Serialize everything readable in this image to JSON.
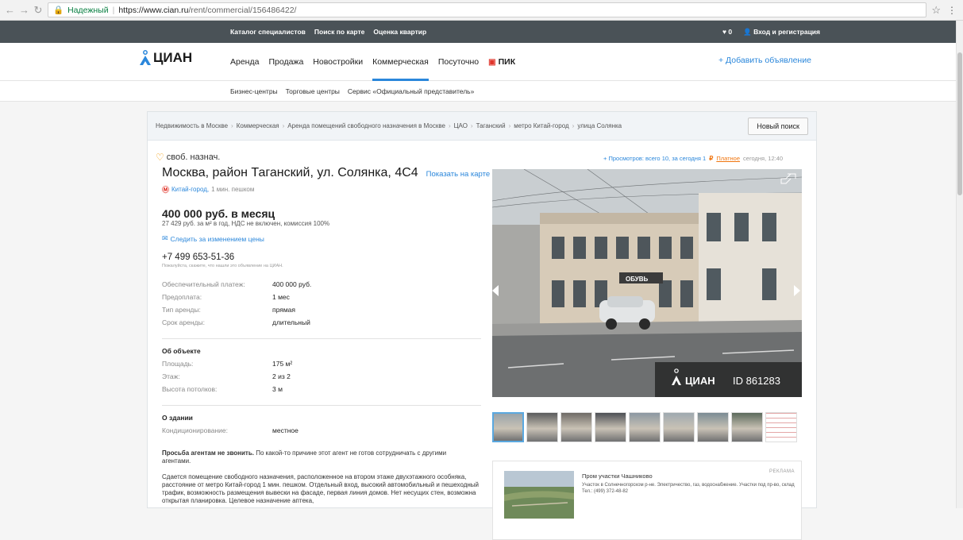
{
  "browser": {
    "secure_label": "Надежный",
    "url_host": "https://www.cian.ru",
    "url_path": "/rent/commercial/156486422/"
  },
  "topbar": {
    "links": [
      "Каталог специалистов",
      "Поиск по карте",
      "Оценка квартир"
    ],
    "favorites_count": "0",
    "login_label": "Вход и регистрация"
  },
  "logo": {
    "text": "ЦИАН"
  },
  "nav": {
    "items": [
      "Аренда",
      "Продажа",
      "Новостройки",
      "Коммерческая",
      "Посуточно"
    ],
    "active_index": 3,
    "pik_label": "ПИК",
    "add_ad_label": "+ Добавить объявление"
  },
  "subnav": {
    "links": [
      "Бизнес-центры",
      "Торговые центры",
      "Сервис «Официальный представитель»"
    ]
  },
  "breadcrumbs": {
    "items": [
      "Недвижимость в Москве",
      "Коммерческая",
      "Аренда помещений свободного назначения в Москве",
      "ЦАО",
      "Таганский",
      "метро Китай-город",
      "улица Солянка"
    ],
    "new_search_label": "Новый поиск"
  },
  "listing": {
    "type_label": "своб. назнач.",
    "title": "Москва, район Таганский, ул. Солянка, 4С4",
    "show_map_label": "Показать на карте",
    "metro_station": "Китай-город,",
    "metro_distance": "1 мин. пешком",
    "price": "400 000 руб. в месяц",
    "price_details": "27 429 руб. за м² в год, НДС не включен, комиссия 100%",
    "follow_price_label": "Следить за изменением цены",
    "phone": "+7 499 653-51-36",
    "phone_note": "Пожалуйста, скажите, что нашли это объявление на ЦИАН.",
    "terms": [
      {
        "k": "Обеспечительный платеж:",
        "v": "400 000 руб."
      },
      {
        "k": "Предоплата:",
        "v": "1 мес"
      },
      {
        "k": "Тип аренды:",
        "v": "прямая"
      },
      {
        "k": "Срок аренды:",
        "v": "длительный"
      }
    ],
    "object_title": "Об объекте",
    "object": [
      {
        "k": "Площадь:",
        "v": "175 м²"
      },
      {
        "k": "Этаж:",
        "v": "2 из 2"
      },
      {
        "k": "Высота потолков:",
        "v": "3 м"
      }
    ],
    "building_title": "О здании",
    "building": [
      {
        "k": "Кондиционирование:",
        "v": "местное"
      }
    ],
    "warning_bold": "Просьба агентам не звонить.",
    "warning_text": " По какой-то причине этот агент не готов сотрудничать с другими агентами.",
    "description": "Сдается помещение свободного назначения, расположенное на втором этаже двухэтажного особняка, расстояние от метро Китай-город 1 мин. пешком. Отдельный вход, высокий автомобильный и пешеходный трафик, возможность размещения вывески на фасаде, первая линия домов. Нет несущих стен, возможна открытая планировка. Целевое назначение аптека,"
  },
  "stats": {
    "views": "Просмотров: всего 10, за сегодня 1",
    "paid_label": "Платное",
    "time": "сегодня, 12:40"
  },
  "photo": {
    "watermark_logo": "ЦИАН",
    "id_label": "ID 861283",
    "shop_sign": "ОБУВЬ"
  },
  "thumbs_count": 9,
  "ad": {
    "tag": "РЕКЛАМА",
    "title": "Пром участки Чашниково",
    "text": "Участок в Солнечногорском р-не. Электричество, газ, водоснабжение. Участки под пр-во, склад",
    "phone": "Тел.: (499) 372-48-82"
  }
}
